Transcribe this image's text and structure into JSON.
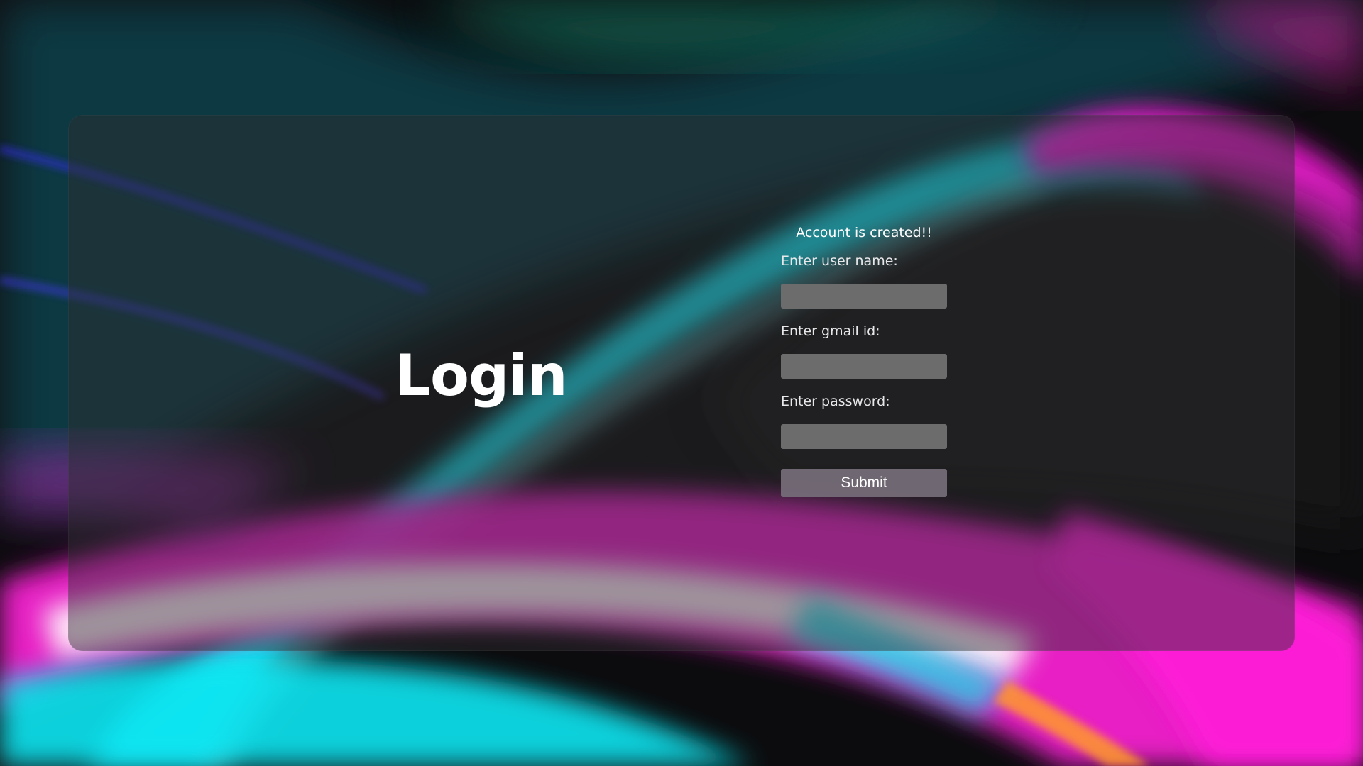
{
  "page": {
    "title": "Login"
  },
  "form": {
    "status_message": "Account is created!!",
    "fields": [
      {
        "label": "Enter user name:",
        "value": "",
        "placeholder": ""
      },
      {
        "label": "Enter gmail id:",
        "value": "",
        "placeholder": ""
      },
      {
        "label": "Enter password:",
        "value": "",
        "placeholder": ""
      }
    ],
    "submit_label": "Submit"
  },
  "colors": {
    "background_dark": "#0c0c0e",
    "panel": "#2e2e30",
    "input_fill": "#6c6c6c",
    "button_fill": "#766e7a",
    "text": "#ffffff",
    "accent_cyan": "#12e6f2",
    "accent_magenta": "#ff1ee0",
    "accent_violet": "#3a2cff"
  },
  "background": {
    "description_icon": "abstract-light-streaks"
  }
}
